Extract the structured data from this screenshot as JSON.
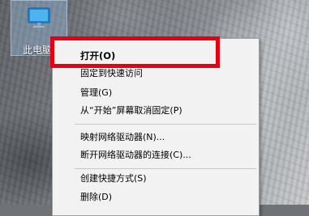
{
  "desktop": {
    "icon_label": "此电脑",
    "icon_name": "this-pc-monitor-icon"
  },
  "context_menu": {
    "items": [
      {
        "label": "打开(O)",
        "bold": true
      },
      {
        "label": "固定到快速访问",
        "bold": false
      },
      {
        "label": "管理(G)",
        "bold": false
      },
      {
        "label": "从“开始”屏幕取消固定(P)",
        "bold": false
      },
      {
        "label": "映射网络驱动器(N)...",
        "bold": false
      },
      {
        "label": "断开网络驱动器的连接(C)...",
        "bold": false
      },
      {
        "label": "创建快捷方式(S)",
        "bold": false
      },
      {
        "label": "删除(D)",
        "bold": false
      }
    ]
  },
  "annotation": {
    "highlight_color": "#e60012"
  }
}
